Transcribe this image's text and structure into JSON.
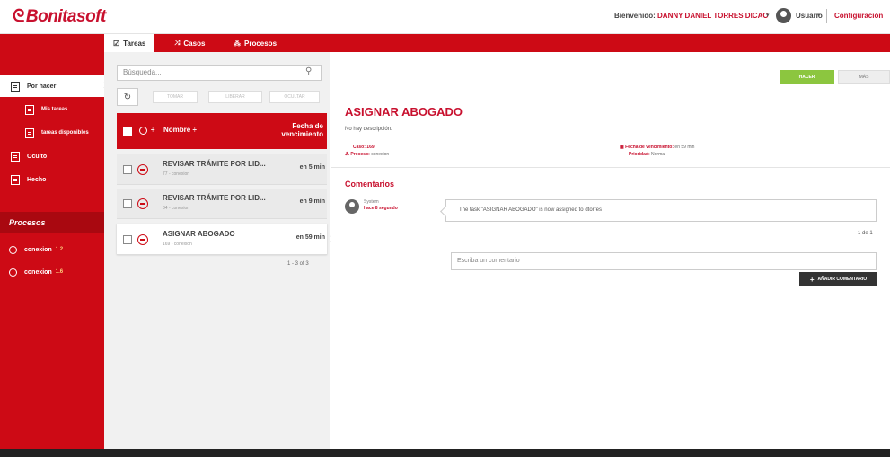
{
  "app": {
    "logo": "Bonitasoft"
  },
  "header": {
    "welcome_label": "Bienvenido:",
    "user_full_name": "DANNY DANIEL TORRES DICAO",
    "user_menu_label": "Usuario",
    "config_label": "Configuración"
  },
  "tabs": [
    {
      "label": "Tareas",
      "icon": "checkbox-icon"
    },
    {
      "label": "Casos",
      "icon": "shuffle-icon"
    },
    {
      "label": "Procesos",
      "icon": "process-icon"
    }
  ],
  "sidebar": {
    "items": [
      {
        "label": "Por hacer"
      },
      {
        "label": "Mis tareas"
      },
      {
        "label": "tareas disponibles"
      },
      {
        "label": "Oculto"
      },
      {
        "label": "Hecho"
      }
    ],
    "processes_title": "Procesos",
    "processes": [
      {
        "name": "conexion",
        "version": "1.2"
      },
      {
        "name": "conexion",
        "version": "1.6"
      }
    ]
  },
  "list": {
    "search_placeholder": "Búsqueda...",
    "toolbar": {
      "take": "TOMAR",
      "release": "LIBERAR",
      "hide": "OCULTAR"
    },
    "header": {
      "sort": "÷",
      "name": "Nombre ÷",
      "due": "Fecha de vencimiento"
    },
    "rows": [
      {
        "title": "REVISAR TRÁMITE POR LID...",
        "sub": "77 - conexion",
        "due": "en 5 min"
      },
      {
        "title": "REVISAR TRÁMITE POR LID...",
        "sub": "84 - conexion",
        "due": "en 9 min"
      },
      {
        "title": "ASIGNAR ABOGADO",
        "sub": "169 - conexion",
        "due": "en 59 min"
      }
    ],
    "pager": "1 - 3 of 3"
  },
  "detail": {
    "do_button": "HACER",
    "more_button": "MÁS",
    "title": "ASIGNAR ABOGADO",
    "description": "No hay descripción.",
    "case_label": "Caso:",
    "case_value": "169",
    "process_label": "Proceso:",
    "process_value": "conexion",
    "due_label": "Fecha de vencimiento:",
    "due_value": "en 59 min",
    "priority_label": "Prioridad:",
    "priority_value": "Normal",
    "comments_title": "Comentarios",
    "comment": {
      "user": "System",
      "time": "hace 8 segundo",
      "text": "The task \"ASIGNAR ABOGADO\" is now assigned to dtorres"
    },
    "comments_pager": "1 de 1",
    "comment_placeholder": "Escriba un comentario",
    "add_comment_button": "AÑADIR COMENTARIO"
  },
  "colors": {
    "brand_red": "#cd0a15",
    "do_green": "#8cc63f"
  }
}
